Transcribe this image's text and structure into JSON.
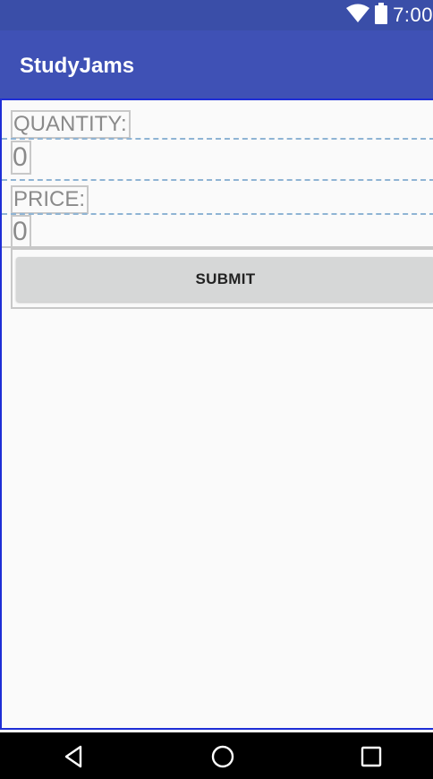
{
  "status_bar": {
    "time": "7:00",
    "icons": [
      "wifi-icon",
      "battery-icon"
    ]
  },
  "app_bar": {
    "title": "StudyJams"
  },
  "form": {
    "quantity_label": "QUANTITY:",
    "quantity_value": "0",
    "price_label": "PRICE:",
    "price_value": "0",
    "submit_label": "SUBMIT"
  },
  "nav_bar": {
    "icons": [
      "back-icon",
      "home-icon",
      "recents-icon"
    ]
  },
  "colors": {
    "primary": "#3f51b5",
    "primary_dark": "#3a4ea8",
    "layout_border": "#1e2ed6",
    "button_bg": "#d6d7d7"
  }
}
